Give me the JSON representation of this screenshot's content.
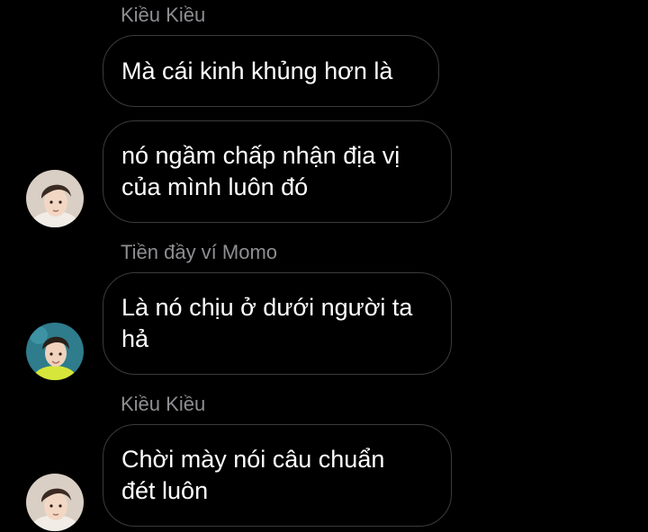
{
  "chat": {
    "messages": [
      {
        "sender": "Kiều Kiều",
        "lines": [
          "Mà cái kinh khủng hơn là"
        ]
      },
      {
        "sender": "",
        "lines": [
          "nó ngầm chấp nhận địa vị",
          "của mình luôn đó"
        ]
      },
      {
        "sender": "Tiền đầy ví Momo",
        "lines": [
          "Là nó chịu ở dưới người ta",
          "hả"
        ]
      },
      {
        "sender": "Kiều Kiều",
        "lines": [
          "Chời mày nói câu chuẩn",
          "đét luôn"
        ]
      }
    ],
    "avatars": [
      {
        "user": "Kiều Kiều",
        "icon": "profile-photo-icon",
        "bg": "#d9cfc4"
      },
      {
        "user": "Tiền đầy ví Momo",
        "icon": "profile-photo-icon",
        "bg": "#2f7c8c",
        "accent": "#d7e63a"
      },
      {
        "user": "Kiều Kiều",
        "icon": "profile-photo-icon",
        "bg": "#d9cfc4"
      }
    ]
  },
  "colors": {
    "background": "#000000",
    "bubble_border": "#3b3b3d",
    "sender_text": "#8e8e93",
    "message_text": "#ffffff"
  }
}
